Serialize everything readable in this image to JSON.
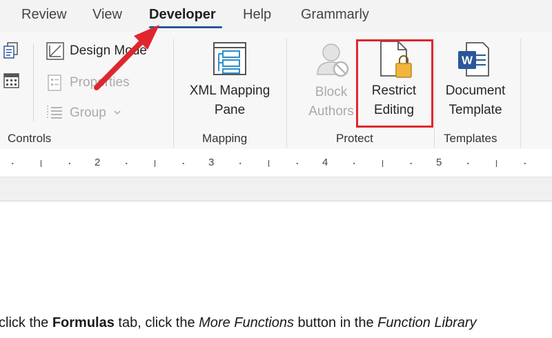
{
  "tabs": [
    {
      "label": "Review",
      "active": false
    },
    {
      "label": "View",
      "active": false
    },
    {
      "label": "Developer",
      "active": true
    },
    {
      "label": "Help",
      "active": false
    },
    {
      "label": "Grammarly",
      "active": false
    }
  ],
  "controls": {
    "design_mode": "Design Mode",
    "properties": "Properties",
    "group": "Group",
    "label": "Controls"
  },
  "mapping": {
    "button_line1": "XML Mapping",
    "button_line2": "Pane",
    "label": "Mapping"
  },
  "protect": {
    "block_line1": "Block",
    "block_line2": "Authors",
    "restrict_line1": "Restrict",
    "restrict_line2": "Editing",
    "label": "Protect"
  },
  "templates": {
    "button_line1": "Document",
    "button_line2": "Template",
    "label": "Templates"
  },
  "ruler": {
    "numbers": [
      "2",
      "3",
      "4",
      "5"
    ]
  },
  "document": {
    "t1": "click the ",
    "t2": "Formulas",
    "t3": " tab, click the ",
    "t4": "More Functions",
    "t5": " button in the ",
    "t6": "Function Library"
  },
  "colors": {
    "accent": "#2b579a",
    "highlight": "#e0262d",
    "arrow": "#e0262d"
  },
  "icons": {
    "left1": "document-icon",
    "left2": "calendar-icon",
    "design": "design-mode-icon",
    "properties": "properties-icon",
    "group": "group-icon",
    "xml": "xml-mapping-pane-icon",
    "block": "block-authors-icon",
    "restrict": "restrict-editing-icon",
    "word": "word-template-icon"
  }
}
